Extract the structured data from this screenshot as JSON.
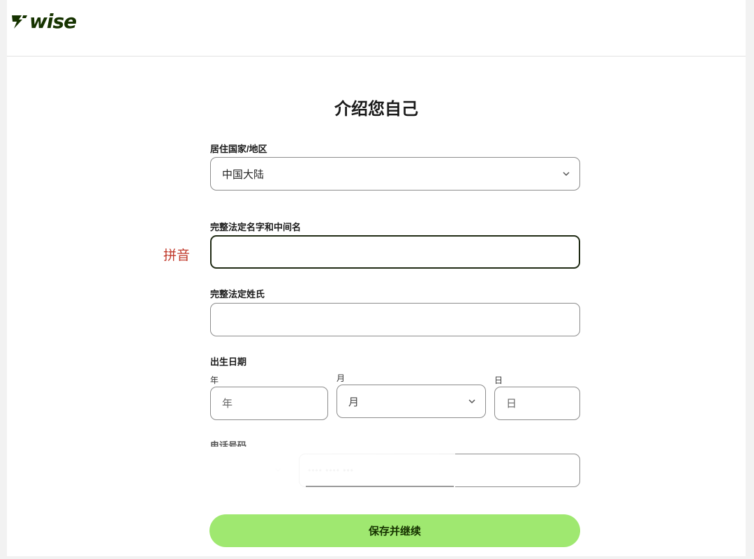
{
  "brand": {
    "name": "wise"
  },
  "page": {
    "title": "介绍您自己"
  },
  "form": {
    "country": {
      "label": "居住国家/地区",
      "value": "中国大陆"
    },
    "first_name": {
      "label": "完整法定名字和中间名",
      "value": "",
      "annotation": "拼音"
    },
    "last_name": {
      "label": "完整法定姓氏",
      "value": ""
    },
    "dob": {
      "label": "出生日期",
      "year": {
        "label": "年",
        "placeholder": "年"
      },
      "month": {
        "label": "月",
        "placeholder": "月"
      },
      "day": {
        "label": "日",
        "placeholder": "日"
      }
    },
    "phone": {
      "label": "电话号码",
      "number_obscured": "•••• •••• •••"
    },
    "submit_label": "保存并继续"
  },
  "colors": {
    "brand_green": "#163300",
    "button_green": "#9fe870",
    "annotation_red": "#c0392b"
  },
  "icons": {
    "dropdown": "chevron-down-icon",
    "logo": "wise-flag-icon"
  }
}
